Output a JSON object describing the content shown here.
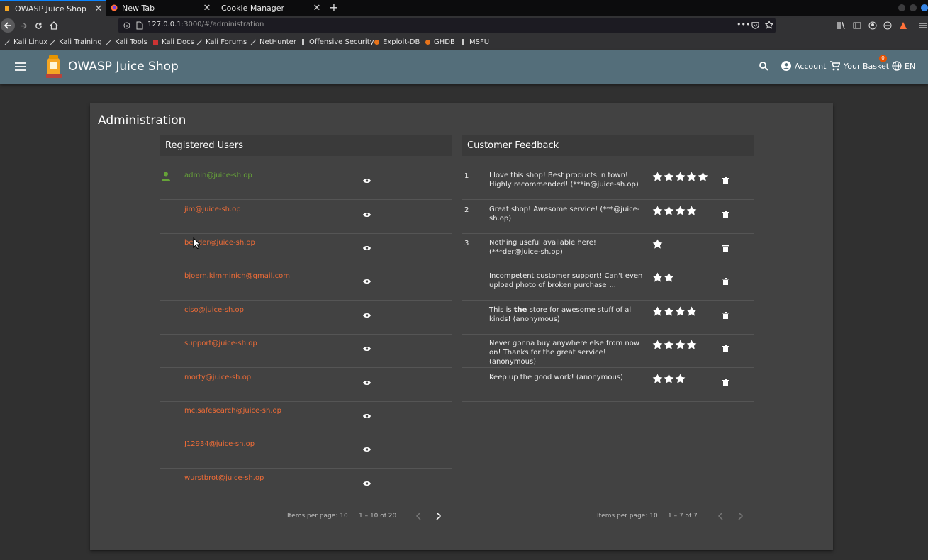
{
  "browser": {
    "tabs": [
      {
        "label": "OWASP Juice Shop",
        "active": true
      },
      {
        "label": "New Tab",
        "active": false
      },
      {
        "label": "Cookie Manager",
        "active": false
      }
    ],
    "url_host": "127.0.0.1",
    "url_rest": ":3000/#/administration",
    "bookmarks": [
      "Kali Linux",
      "Kali Training",
      "Kali Tools",
      "Kali Docs",
      "Kali Forums",
      "NetHunter",
      "Offensive Security",
      "Exploit-DB",
      "GHDB",
      "MSFU"
    ]
  },
  "app": {
    "brand": "OWASP Juice Shop",
    "account_label": "Account",
    "basket_label": "Your Basket",
    "basket_count": "0",
    "language": "EN",
    "colors": {
      "toolbar": "#546e7a",
      "accent_link": "#ef6c37",
      "admin_user": "#66a338"
    }
  },
  "page": {
    "title": "Administration",
    "users_title": "Registered Users",
    "feedback_title": "Customer Feedback"
  },
  "users": [
    "admin@juice-sh.op",
    "jim@juice-sh.op",
    "bender@juice-sh.op",
    "bjoern.kimminich@gmail.com",
    "ciso@juice-sh.op",
    "support@juice-sh.op",
    "morty@juice-sh.op",
    "mc.safesearch@juice-sh.op",
    "J12934@juice-sh.op",
    "wurstbrot@juice-sh.op"
  ],
  "feedback": [
    {
      "id": "1",
      "text": "I love this shop! Best products in town! Highly recommended! (***in@juice-sh.op)",
      "rating": 5
    },
    {
      "id": "2",
      "text": "Great shop! Awesome service! (***@juice-sh.op)",
      "rating": 4
    },
    {
      "id": "3",
      "text": "Nothing useful available here! (***der@juice-sh.op)",
      "rating": 1
    },
    {
      "id": "",
      "text": "Incompetent customer support! Can't even upload photo of broken purchase!...",
      "rating": 2
    },
    {
      "id": "",
      "text_before": "This is ",
      "text_bold": "the",
      "text_after": " store for awesome stuff of all kinds! (anonymous)",
      "rating": 4
    },
    {
      "id": "",
      "text": "Never gonna buy anywhere else from now on! Thanks for the great service! (anonymous)",
      "rating": 4
    },
    {
      "id": "",
      "text": "Keep up the good work! (anonymous)",
      "rating": 3
    }
  ],
  "users_paginator": {
    "items_per_page": "Items per page: 10",
    "range": "1 – 10 of 20"
  },
  "feedback_paginator": {
    "items_per_page": "Items per page: 10",
    "range": "1 – 7 of 7"
  }
}
